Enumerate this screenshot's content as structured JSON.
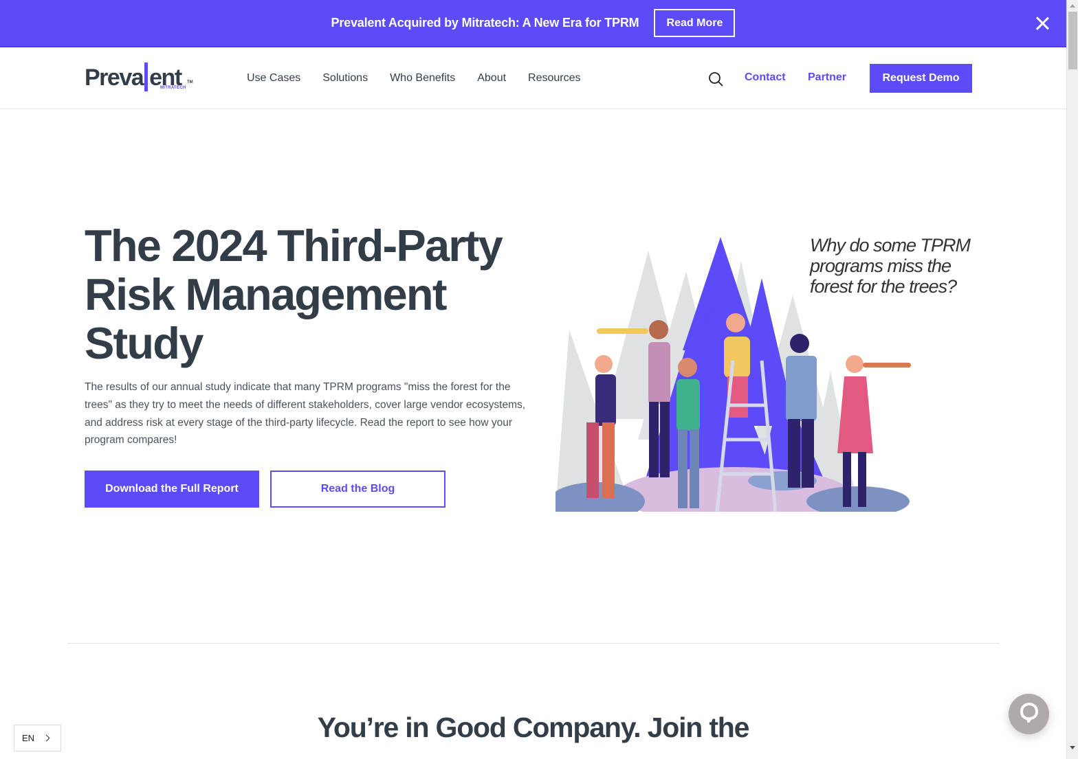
{
  "banner": {
    "text": "Prevalent Acquired by Mitratech: A New Era for TPRM",
    "button_label": "Read More",
    "close_icon": "close-icon",
    "background_color": "#5b4bf8"
  },
  "header": {
    "logo": {
      "word_left": "Preva",
      "word_right": "ent",
      "sub": "MITRATECH",
      "tm": "TM"
    },
    "nav_items": [
      {
        "label": "Use Cases"
      },
      {
        "label": "Solutions"
      },
      {
        "label": "Who Benefits"
      },
      {
        "label": "About"
      },
      {
        "label": "Resources"
      }
    ],
    "search_icon": "search-icon",
    "contact_label": "Contact",
    "partner_label": "Partner",
    "demo_label": "Request Demo",
    "accent_color": "#5b4bf8"
  },
  "hero": {
    "title": "The 2024 Third-Party Risk Management Study",
    "body": "The results of our annual study indicate that many TPRM programs \"miss the forest for the trees\" as they try to meet the needs of different stakeholders, cover large vendor ecosystems, and address risk at every stage of the third-party lifecycle. Read the report to see how your program compares!",
    "primary_button": "Download the Full Report",
    "secondary_button": "Read the Blog",
    "illustration_caption": "Why do some TPRM programs miss the forest  for the trees?",
    "illustration": "people-looking-through-binoculars-and-telescopes-in-forest"
  },
  "section": {
    "title": "You’re in Good Company. Join the"
  },
  "language": {
    "current": "EN",
    "chevron_icon": "chevron-right-icon"
  },
  "chat": {
    "icon": "chat-bubble-icon"
  }
}
